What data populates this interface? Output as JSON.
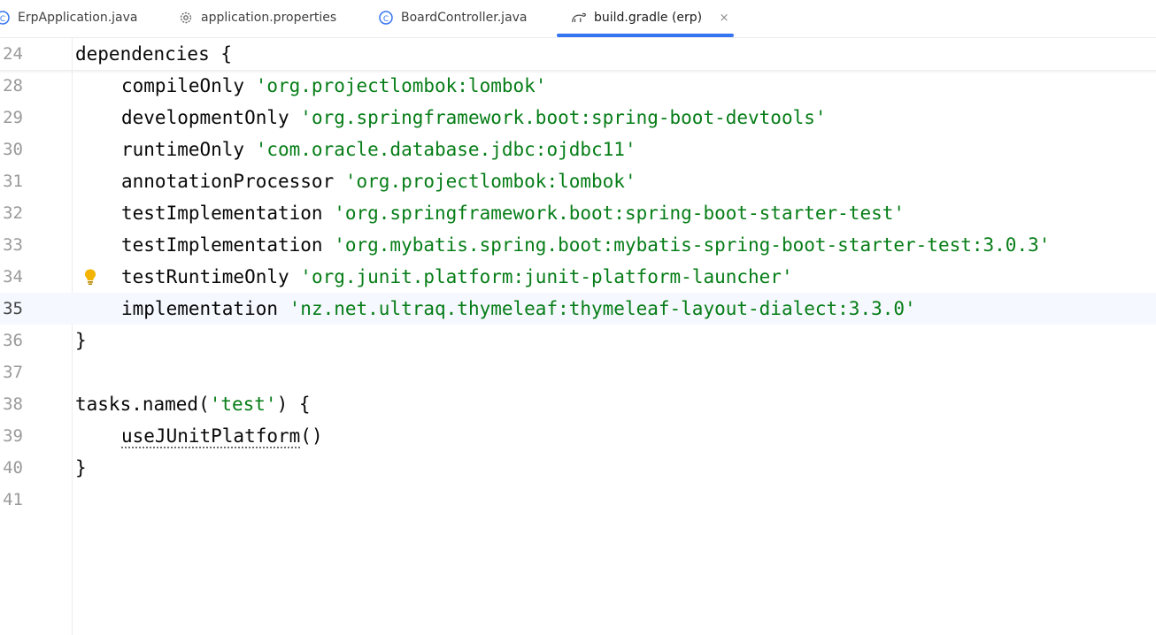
{
  "tabs": [
    {
      "label": "ErpApplication.java",
      "icon": "java-class-icon"
    },
    {
      "label": "application.properties",
      "icon": "gear-icon"
    },
    {
      "label": "BoardController.java",
      "icon": "java-class-icon"
    },
    {
      "label": "build.gradle (erp)",
      "icon": "gradle-elephant-icon",
      "active": true,
      "close": "×"
    }
  ],
  "accent_color": "#3574f0",
  "string_color": "#067d17",
  "lines": [
    {
      "num": "24",
      "indent": "",
      "code": "dependencies {",
      "str": "",
      "tail": ""
    },
    {
      "num": "28",
      "indent": "    ",
      "code": "compileOnly ",
      "str": "'org.projectlombok:lombok'",
      "tail": ""
    },
    {
      "num": "29",
      "indent": "    ",
      "code": "developmentOnly ",
      "str": "'org.springframework.boot:spring-boot-devtools'",
      "tail": ""
    },
    {
      "num": "30",
      "indent": "    ",
      "code": "runtimeOnly ",
      "str": "'com.oracle.database.jdbc:ojdbc11'",
      "tail": ""
    },
    {
      "num": "31",
      "indent": "    ",
      "code": "annotationProcessor ",
      "str": "'org.projectlombok:lombok'",
      "tail": ""
    },
    {
      "num": "32",
      "indent": "    ",
      "code": "testImplementation ",
      "str": "'org.springframework.boot:spring-boot-starter-test'",
      "tail": ""
    },
    {
      "num": "33",
      "indent": "    ",
      "code": "testImplementation ",
      "str": "'org.mybatis.spring.boot:mybatis-spring-boot-starter-test:3.0.3'",
      "tail": ""
    },
    {
      "num": "34",
      "indent": "    ",
      "code": "testRuntimeOnly ",
      "str": "'org.junit.platform:junit-platform-launcher'",
      "tail": "",
      "bulb": "lightbulb-icon"
    },
    {
      "num": "35",
      "indent": "    ",
      "code": "implementation ",
      "str": "'nz.net.ultraq.thymeleaf:thymeleaf-layout-dialect:3.3.0'",
      "tail": "",
      "current": true
    },
    {
      "num": "36",
      "indent": "",
      "code": "}",
      "str": "",
      "tail": ""
    },
    {
      "num": "37",
      "indent": "",
      "code": "",
      "str": "",
      "tail": ""
    },
    {
      "num": "38",
      "indent": "",
      "code": "tasks.named(",
      "str": "'test'",
      "tail": ") {"
    },
    {
      "num": "39",
      "indent": "    ",
      "code": "useJUnitPlatform",
      "str": "",
      "tail": "()"
    },
    {
      "num": "40",
      "indent": "",
      "code": "}",
      "str": "",
      "tail": ""
    },
    {
      "num": "41",
      "indent": "",
      "code": "",
      "str": "",
      "tail": ""
    }
  ]
}
